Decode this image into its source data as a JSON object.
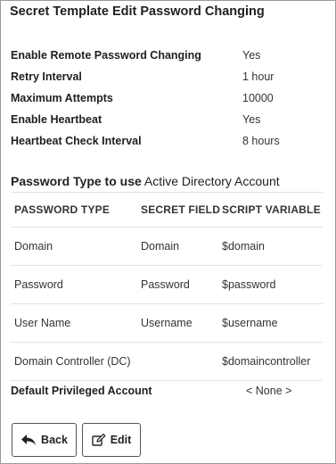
{
  "title": "Secret Template Edit Password Changing",
  "settings": [
    {
      "label": "Enable Remote Password Changing",
      "value": "Yes"
    },
    {
      "label": "Retry Interval",
      "value": "1 hour"
    },
    {
      "label": "Maximum Attempts",
      "value": "10000"
    },
    {
      "label": "Enable Heartbeat",
      "value": "Yes"
    },
    {
      "label": "Heartbeat Check Interval",
      "value": "8 hours"
    }
  ],
  "password_type": {
    "label": "Password Type to use",
    "value": "Active Directory Account"
  },
  "table": {
    "headers": [
      "PASSWORD TYPE",
      "SECRET FIELD",
      "SCRIPT VARIABLE"
    ],
    "rows": [
      [
        "Domain",
        "Domain",
        "$domain"
      ],
      [
        "Password",
        "Password",
        "$password"
      ],
      [
        "User Name",
        "Username",
        "$username"
      ],
      [
        "Domain Controller (DC)",
        "",
        "$domaincontroller"
      ]
    ]
  },
  "privileged": {
    "label": "Default Privileged Account",
    "value": "< None >"
  },
  "buttons": {
    "back": "Back",
    "edit": "Edit"
  },
  "icons": {
    "back": "reply-arrow-icon",
    "edit": "edit-icon"
  }
}
